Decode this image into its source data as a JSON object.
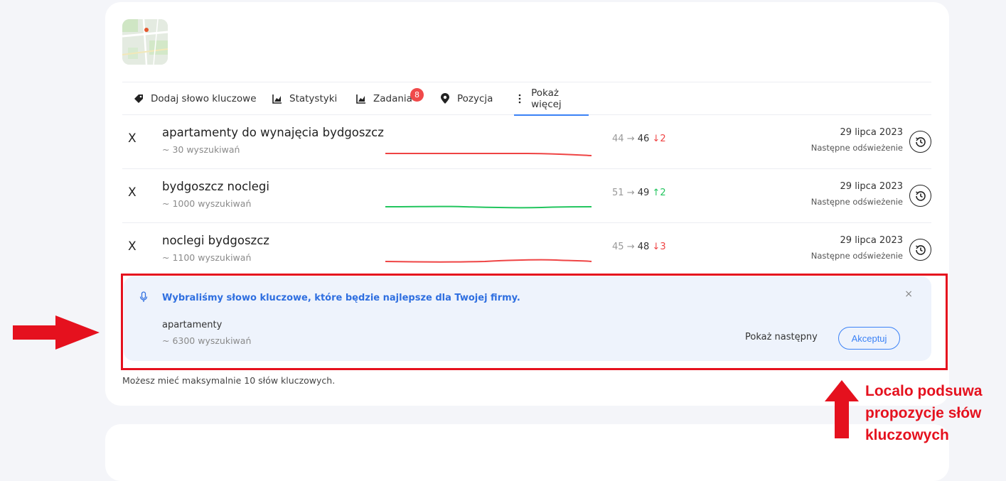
{
  "tabs": [
    {
      "label": "Dodaj słowo kluczowe",
      "icon": "tag-icon"
    },
    {
      "label": "Statystyki",
      "icon": "chart-icon"
    },
    {
      "label": "Zadania",
      "icon": "chart-icon",
      "badge": "8"
    },
    {
      "label": "Pozycja",
      "icon": "location-pin-icon"
    },
    {
      "label": "Pokaż więcej",
      "icon": "more-vertical-icon",
      "active": true
    }
  ],
  "keywords": [
    {
      "remove": "X",
      "keyword": "apartamenty do wynajęcia bydgoszcz",
      "searches": "~ 30 wyszukiwań",
      "prev": "44",
      "arrow": "→",
      "current": "46",
      "change_dir": "↓",
      "change": "2",
      "trend": "down",
      "date": "29 lipca 2023",
      "next_refresh": "Następne odświeżenie"
    },
    {
      "remove": "X",
      "keyword": "bydgoszcz noclegi",
      "searches": "~ 1000 wyszukiwań",
      "prev": "51",
      "arrow": "→",
      "current": "49",
      "change_dir": "↑",
      "change": "2",
      "trend": "up",
      "date": "29 lipca 2023",
      "next_refresh": "Następne odświeżenie"
    },
    {
      "remove": "X",
      "keyword": "noclegi bydgoszcz",
      "searches": "~ 1100 wyszukiwań",
      "prev": "45",
      "arrow": "→",
      "current": "48",
      "change_dir": "↓",
      "change": "3",
      "trend": "down",
      "date": "29 lipca 2023",
      "next_refresh": "Następne odświeżenie"
    }
  ],
  "suggestion": {
    "message": "Wybraliśmy słowo kluczowe, które będzie najlepsze dla Twojej firmy.",
    "close": "×",
    "keyword": "apartamenty",
    "searches": "~ 6300 wyszukiwań",
    "next_label": "Pokaż następny",
    "accept_label": "Akceptuj"
  },
  "max_info": "Możesz mieć maksymalnie 10 słów kluczowych.",
  "annotation": {
    "text": "Localo podsuwa propozycje słów kluczowych",
    "color": "#e5111e"
  },
  "colors": {
    "accent": "#3b82f6",
    "trend_down": "#ef4444",
    "trend_up": "#22c55e"
  }
}
